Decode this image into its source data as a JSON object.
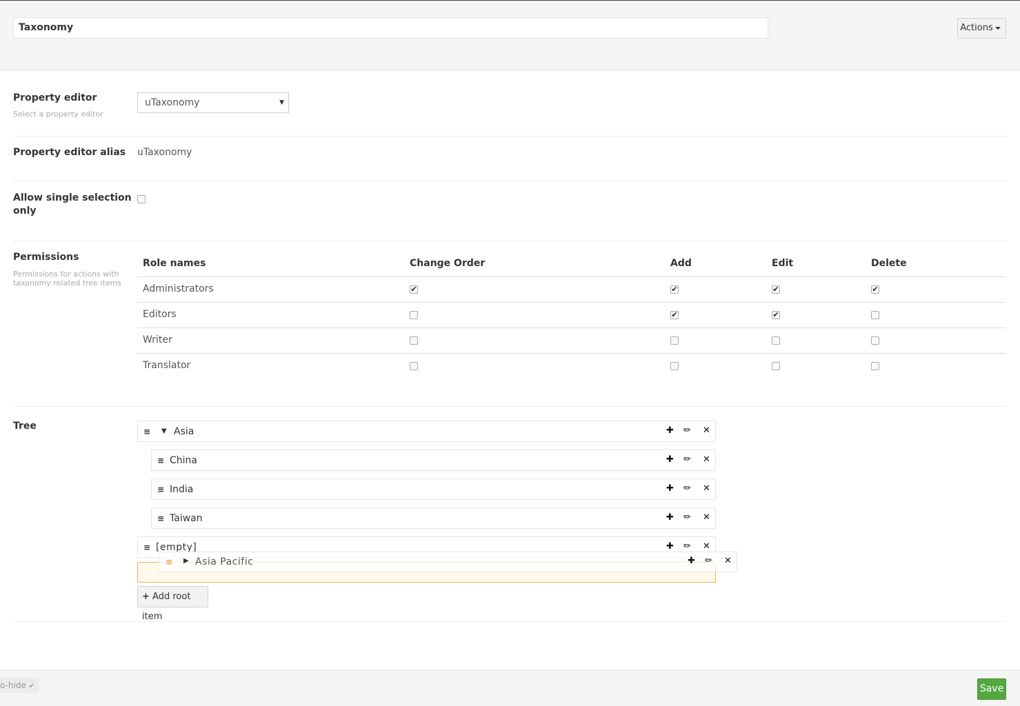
{
  "header": {
    "name_value": "Taxonomy",
    "actions_label": "Actions"
  },
  "property_editor": {
    "label": "Property editor",
    "description": "Select a property editor",
    "selected": "uTaxonomy",
    "alias_label": "Property editor alias",
    "alias_value": "uTaxonomy"
  },
  "single_selection": {
    "label_line1": "Allow single selection",
    "label_line2": "only",
    "checked": false
  },
  "permissions": {
    "label": "Permissions",
    "desc_line1": "Permissions for actions with",
    "desc_line2": "taxonomy related tree items",
    "columns": [
      "Role names",
      "Change Order",
      "Add",
      "Edit",
      "Delete"
    ],
    "rows": [
      {
        "role": "Administrators",
        "change_order": true,
        "add": true,
        "edit": true,
        "delete": true
      },
      {
        "role": "Editors",
        "change_order": false,
        "add": true,
        "edit": true,
        "delete": false
      },
      {
        "role": "Writer",
        "change_order": false,
        "add": false,
        "edit": false,
        "delete": false
      },
      {
        "role": "Translator",
        "change_order": false,
        "add": false,
        "edit": false,
        "delete": false
      }
    ]
  },
  "tree": {
    "label": "Tree",
    "root": "Asia",
    "children": [
      "China",
      "India",
      "Taiwan"
    ],
    "empty_item": "[empty]",
    "dragging_item": "Asia Pacific",
    "add_root_label": "Add root item"
  },
  "icons": {
    "handle": "drag-handle-icon",
    "add": "plus-icon",
    "edit": "pencil-icon",
    "remove": "close-icon"
  },
  "footer": {
    "autohide_label": "o-hide",
    "save_label": "Save"
  },
  "colors": {
    "save": "#53a93f",
    "drop_placeholder_border": "#e5b54a",
    "drag_handle": "#e5a43c"
  }
}
